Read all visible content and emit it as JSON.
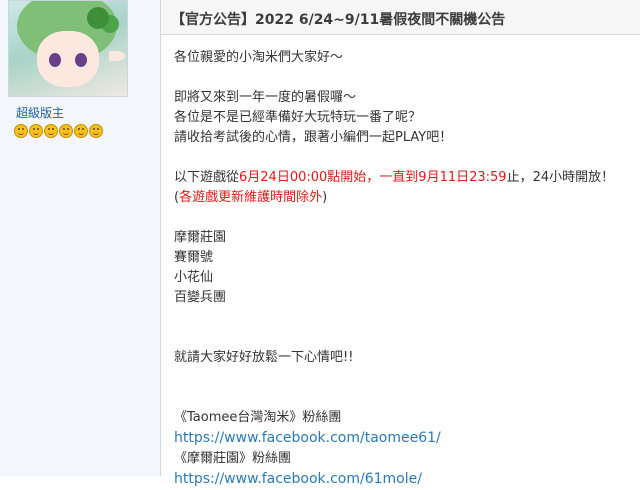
{
  "user": {
    "title": "超級版主",
    "avatar_icon": "character-avatar",
    "rank_icon": "smiley-icon",
    "rank_count": 6
  },
  "post": {
    "title": "【官方公告】2022 6/24~9/11暑假夜間不關機公告",
    "greeting": "各位親愛的小淘米們大家好～",
    "intro_1": "即將又來到一年一度的暑假囉～",
    "intro_2": "各位是不是已經準備好大玩特玩一番了呢？",
    "intro_3": "請收拾考試後的心情，跟著小編們一起PLAY吧！",
    "schedule": {
      "part1": "以下遊戲從",
      "part2": "6月24日00:00點開始，一直到9月11日23:59",
      "part3": "止，24小時開放！",
      "note_open": "(",
      "note": "各遊戲更新維護時間除外",
      "note_close": ")"
    },
    "games": [
      "摩爾莊園",
      "賽爾號",
      "小花仙",
      "百變兵團"
    ],
    "closing": "就請大家好好放鬆一下心情吧!!",
    "fanpages": [
      {
        "label": "《Taomee台灣淘米》粉絲團",
        "url": "https://www.facebook.com/taomee61/"
      },
      {
        "label": "《摩爾莊園》粉絲團",
        "url": "https://www.facebook.com/61mole/"
      }
    ]
  },
  "colors": {
    "highlight": "#e21818",
    "link": "#2a7ab8",
    "username": "#1e5fa8"
  }
}
